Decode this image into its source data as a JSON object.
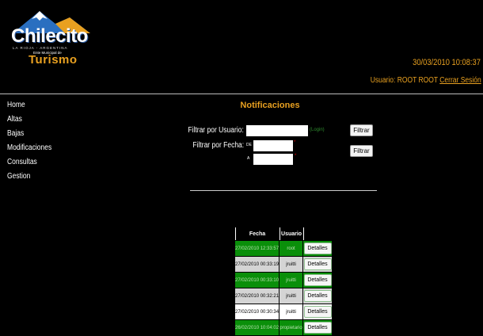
{
  "logo": {
    "name": "Chilecito",
    "region": "LA RIOJA - ARGENTINA",
    "ente": "Ente Municipal de",
    "turismo": "Turismo"
  },
  "header": {
    "datetime": "30/03/2010 10:08:37",
    "user_label": "Usuario: ROOT ROOT",
    "logout": "Cerrar Sesión"
  },
  "sidebar": {
    "items": [
      {
        "label": "Home"
      },
      {
        "label": "Altas"
      },
      {
        "label": "Bajas"
      },
      {
        "label": "Modificaciones"
      },
      {
        "label": "Consultas"
      },
      {
        "label": "Gestion"
      }
    ]
  },
  "main": {
    "title": "Notificaciones",
    "filter_user_label": "Filtrar por Usuario:",
    "filter_user_value": "",
    "login_hint": "(Login)",
    "filter_button": "Filtrar",
    "filter_date_label": "Filtrar por Fecha:",
    "date_from_label": "DE",
    "date_to_label": "A",
    "date_from_value": "",
    "date_to_value": "",
    "date_marker": "*",
    "filter_date_button": "Filtrar"
  },
  "table": {
    "headers": [
      "Fecha",
      "Usuario",
      ""
    ],
    "rows": [
      {
        "fecha": "27/02/2010 12:33:57",
        "usuario": "root",
        "action": "Detalles",
        "style": "green"
      },
      {
        "fecha": "27/02/2010 00:33:19",
        "usuario": "jruitti",
        "action": "Detalles",
        "style": "gray"
      },
      {
        "fecha": "27/02/2010 00:33:10",
        "usuario": "jruitti",
        "action": "Detalles",
        "style": "green"
      },
      {
        "fecha": "27/02/2010 00:32:21",
        "usuario": "jruitti",
        "action": "Detalles",
        "style": "gray"
      },
      {
        "fecha": "27/02/2010 00:30:34",
        "usuario": "jruitti",
        "action": "Detalles",
        "style": "white"
      },
      {
        "fecha": "26/02/2010 10:04:02",
        "usuario": "propietario",
        "action": "Detalles",
        "style": "green"
      }
    ]
  },
  "colors": {
    "accent": "#e8a020",
    "row_green": "#0a8f0a",
    "row_gray": "#d4d4d4",
    "background": "#000000"
  }
}
